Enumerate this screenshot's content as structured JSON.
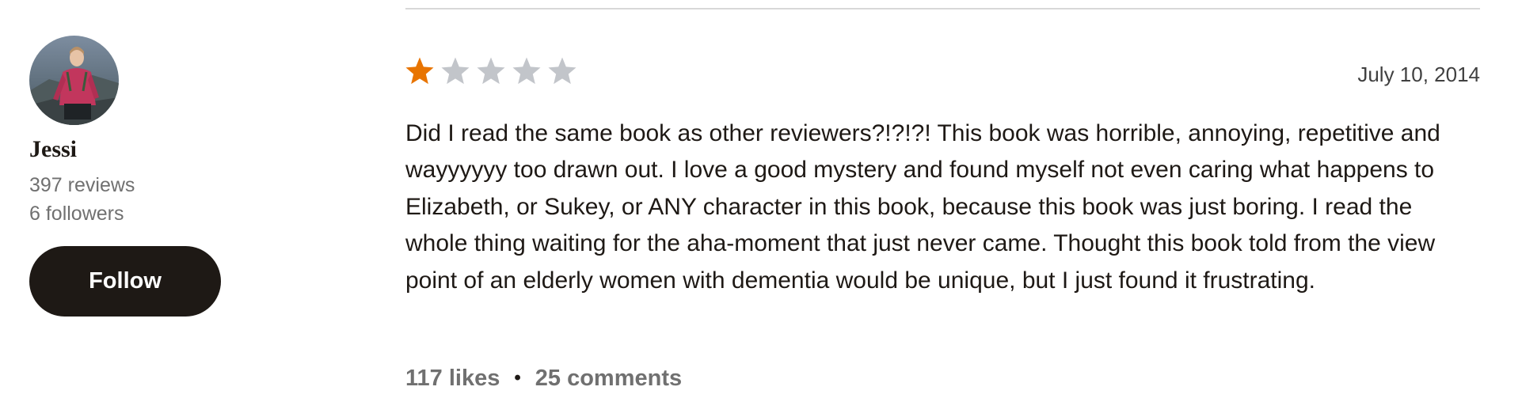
{
  "reviewer": {
    "name": "Jessi",
    "reviews": "397 reviews",
    "followers": "6 followers",
    "follow_label": "Follow"
  },
  "review": {
    "rating": 1,
    "max_rating": 5,
    "star_filled_color": "#e87400",
    "star_empty_color": "#c2c5ca",
    "date": "July 10, 2014",
    "text": "Did I read the same book as other reviewers?!?!?! This book was horrible, annoying, repetitive and wayyyyyy too drawn out. I love a good mystery and found myself not even caring what happens to Elizabeth, or Sukey, or ANY character in this book, because this book was just boring. I read the whole thing waiting for the aha-moment that just never came. Thought this book told from the view point of an elderly women with dementia would be unique, but I just found it frustrating.",
    "likes": "117 likes",
    "separator": "•",
    "comments": "25 comments"
  }
}
